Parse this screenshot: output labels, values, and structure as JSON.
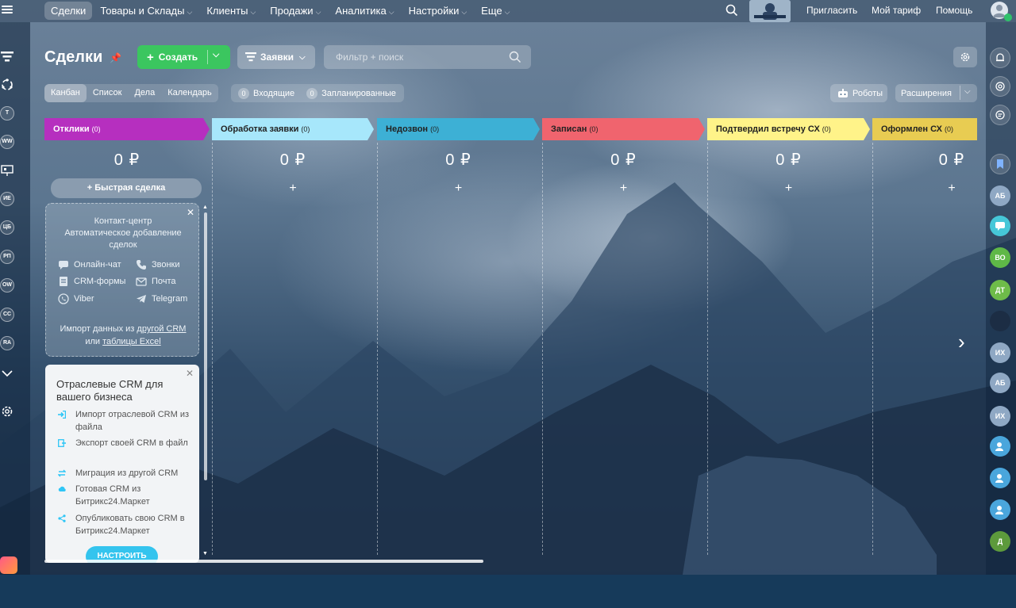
{
  "topbar": {
    "nav": [
      {
        "label": "Сделки",
        "caret": false,
        "active": true
      },
      {
        "label": "Товары и Склады",
        "caret": true,
        "active": false
      },
      {
        "label": "Клиенты",
        "caret": true,
        "active": false
      },
      {
        "label": "Продажи",
        "caret": true,
        "active": false
      },
      {
        "label": "Аналитика",
        "caret": true,
        "active": false
      },
      {
        "label": "Настройки",
        "caret": true,
        "active": false
      },
      {
        "label": "Еще",
        "caret": true,
        "active": false
      }
    ],
    "invite": "Пригласить",
    "tariff": "Мой тариф",
    "help": "Помощь"
  },
  "left_rail": {
    "badges": [
      "Т",
      "WW",
      "ИЕ",
      "ЦБ",
      "РП",
      "OW",
      "СС",
      "RA"
    ]
  },
  "header": {
    "title": "Сделки",
    "create_label": "Создать",
    "requests_label": "Заявки",
    "search_placeholder": "Фильтр + поиск"
  },
  "views": {
    "tabs": [
      "Канбан",
      "Список",
      "Дела",
      "Календарь"
    ],
    "active": "Канбан",
    "counters": [
      {
        "count": "0",
        "label": "Входящие"
      },
      {
        "count": "0",
        "label": "Запланированные"
      }
    ],
    "robots": "Роботы",
    "extensions": "Расширения"
  },
  "kanban": {
    "columns": [
      {
        "title": "Отклики",
        "count": "(0)",
        "sum": "0 ₽",
        "color": "#b62fbf"
      },
      {
        "title": "Обработка заявки",
        "count": "(0)",
        "sum": "0 ₽",
        "color": "#a7e7fb"
      },
      {
        "title": "Недозвон",
        "count": "(0)",
        "sum": "0 ₽",
        "color": "#3db0d5"
      },
      {
        "title": "Записан",
        "count": "(0)",
        "sum": "0 ₽",
        "color": "#f0646e"
      },
      {
        "title": "Подтвердил встречу СХ",
        "count": "(0)",
        "sum": "0 ₽",
        "color": "#fff389"
      },
      {
        "title": "Оформлен СХ",
        "count": "(0)",
        "sum": "0 ₽",
        "color": "#e8cc52"
      }
    ],
    "quick_deal": "Быстрая сделка",
    "contact_center": {
      "title_1": "Контакт-центр",
      "title_2": "Автоматическое добавление",
      "title_3": "сделок",
      "channels": [
        "Онлайн-чат",
        "Звонки",
        "CRM-формы",
        "Почта",
        "Viber",
        "Telegram"
      ],
      "import_1": "Импорт данных из",
      "import_link1": "другой CRM",
      "import_2": "или",
      "import_link2": "таблицы Excel"
    },
    "industry_crm": {
      "title": "Отраслевые CRM для вашего бизнеса",
      "items": [
        "Импорт отраслевой CRM из файла",
        "Экспорт своей CRM в файл",
        "Миграция из другой CRM",
        "Готовая CRM из Битрикс24.Маркет",
        "Опубликовать свою CRM в Битрикс24.Маркет"
      ],
      "button": "НАСТРОИТЬ"
    }
  },
  "right_rail": {
    "avatars": [
      {
        "initials": "АБ",
        "color": "#8fa8c4"
      },
      {
        "initials": "",
        "color": "#46c7d8"
      },
      {
        "initials": "ВО",
        "color": "#5fb847"
      },
      {
        "initials": "ДТ",
        "color": "#6ebc49"
      },
      {
        "initials": "",
        "color": "#1c2d44"
      },
      {
        "initials": "ИХ",
        "color": "#8fa8c4"
      },
      {
        "initials": "АБ",
        "color": "#8fa8c4"
      },
      {
        "initials": "ИХ",
        "color": "#8fa8c4"
      },
      {
        "initials": "",
        "color": "#4aa6dc"
      },
      {
        "initials": "",
        "color": "#4aa6dc"
      },
      {
        "initials": "",
        "color": "#4aa6dc"
      },
      {
        "initials": "Д",
        "color": "#5d9a3c"
      }
    ]
  }
}
